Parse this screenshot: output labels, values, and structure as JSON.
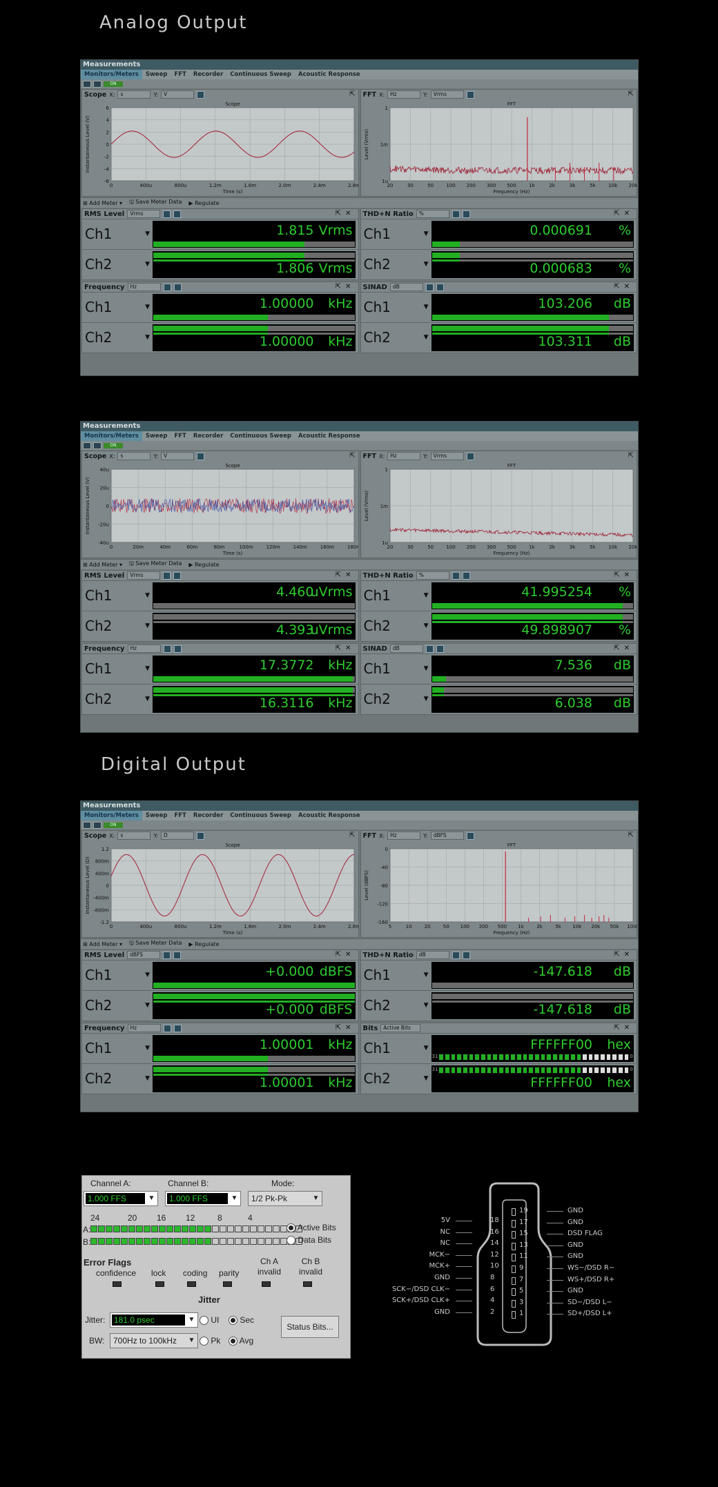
{
  "sections": {
    "analog": "Analog Output",
    "digital": "Digital Output"
  },
  "window": {
    "title": "Measurements",
    "tabs": [
      "Monitors/Meters",
      "Sweep",
      "FFT",
      "Recorder",
      "Continuous Sweep",
      "Acoustic Response"
    ],
    "on_label": "ON",
    "toolbar": {
      "add_meter": "Add Meter",
      "save_meter_data": "Save Meter Data",
      "regulate": "Regulate"
    }
  },
  "panel1": {
    "scope": {
      "title": "Scope",
      "x_label": "X:",
      "x_unit": "s",
      "y_label": "Y:",
      "y_unit": "V",
      "plot_title": "Scope",
      "xlabel": "Time (s)",
      "ylabel": "Instantaneous Level (V)",
      "yticks": [
        "6",
        "4",
        "2",
        "0",
        "-2",
        "-4",
        "-6"
      ],
      "xticks": [
        "0",
        "400u",
        "800u",
        "1.2m",
        "1.6m",
        "2.0m",
        "2.4m",
        "2.8m"
      ]
    },
    "fft": {
      "title": "FFT",
      "x_label": "X:",
      "x_unit": "Hz",
      "y_label": "Y:",
      "y_unit": "Vrms",
      "plot_title": "FFT",
      "xlabel": "Frequency (Hz)",
      "ylabel": "Level (Vrms)",
      "yticks": [
        "1",
        "1m",
        "1u"
      ],
      "xticks": [
        "20",
        "30",
        "50",
        "100",
        "200",
        "300",
        "500",
        "1k",
        "2k",
        "3k",
        "5k",
        "10k",
        "20k"
      ]
    },
    "rms": {
      "title": "RMS Level",
      "unit_sel": "Vrms",
      "ch1": "Ch1",
      "ch2": "Ch2",
      "v1": "1.815",
      "v2": "1.806",
      "u": "Vrms",
      "f1": 0.75,
      "f2": 0.75
    },
    "thd": {
      "title": "THD+N Ratio",
      "unit_sel": "%",
      "ch1": "Ch1",
      "ch2": "Ch2",
      "v1": "0.000691",
      "v2": "0.000683",
      "u": "%",
      "f1": 0.14,
      "f2": 0.14
    },
    "freq": {
      "title": "Frequency",
      "unit_sel": "Hz",
      "ch1": "Ch1",
      "ch2": "Ch2",
      "v1": "1.00000",
      "v2": "1.00000",
      "u": "kHz",
      "f1": 0.57,
      "f2": 0.57
    },
    "sinad": {
      "title": "SINAD",
      "unit_sel": "dB",
      "ch1": "Ch1",
      "ch2": "Ch2",
      "v1": "103.206",
      "v2": "103.311",
      "u": "dB",
      "f1": 0.88,
      "f2": 0.88
    }
  },
  "panel2": {
    "scope": {
      "title": "Scope",
      "x_label": "X:",
      "x_unit": "s",
      "y_label": "Y:",
      "y_unit": "V",
      "plot_title": "Scope",
      "xlabel": "Time (s)",
      "ylabel": "Instantaneous Level (V)",
      "yticks": [
        "40u",
        "20u",
        "0",
        "-20u",
        "-40u"
      ],
      "xticks": [
        "0",
        "20m",
        "40m",
        "60m",
        "80m",
        "100m",
        "120m",
        "140m",
        "160m",
        "180m"
      ]
    },
    "fft": {
      "title": "FFT",
      "x_label": "X:",
      "x_unit": "Hz",
      "y_label": "Y:",
      "y_unit": "Vrms",
      "plot_title": "FFT",
      "xlabel": "Frequency (Hz)",
      "ylabel": "Level (Vrms)",
      "yticks": [
        "1",
        "1m",
        "1u"
      ],
      "xticks": [
        "20",
        "30",
        "50",
        "100",
        "200",
        "300",
        "500",
        "1k",
        "2k",
        "3k",
        "5k",
        "10k",
        "20k"
      ]
    },
    "rms": {
      "title": "RMS Level",
      "unit_sel": "Vrms",
      "ch1": "Ch1",
      "ch2": "Ch2",
      "v1": "4.460",
      "v2": "4.393",
      "u": "uVrms",
      "f1": 0.0,
      "f2": 0.0
    },
    "thd": {
      "title": "THD+N Ratio",
      "unit_sel": "%",
      "ch1": "Ch1",
      "ch2": "Ch2",
      "v1": "41.995254",
      "v2": "49.898907",
      "u": "%",
      "f1": 0.95,
      "f2": 0.95
    },
    "freq": {
      "title": "Frequency",
      "unit_sel": "Hz",
      "ch1": "Ch1",
      "ch2": "Ch2",
      "v1": "17.3772",
      "v2": "16.3116",
      "u": "kHz",
      "f1": 0.99,
      "f2": 0.99
    },
    "sinad": {
      "title": "SINAD",
      "unit_sel": "dB",
      "ch1": "Ch1",
      "ch2": "Ch2",
      "v1": "7.536",
      "v2": "6.038",
      "u": "dB",
      "f1": 0.07,
      "f2": 0.06
    }
  },
  "panel3": {
    "scope": {
      "title": "Scope",
      "x_label": "X:",
      "x_unit": "s",
      "y_label": "Y:",
      "y_unit": "D",
      "plot_title": "Scope",
      "xlabel": "Time (s)",
      "ylabel": "Instantaneous Level (D)",
      "yticks": [
        "1.2",
        "800m",
        "400m",
        "0",
        "-400m",
        "-800m",
        "-1.2"
      ],
      "xticks": [
        "0",
        "400u",
        "800u",
        "1.2m",
        "1.6m",
        "2.0m",
        "2.4m",
        "2.8m"
      ]
    },
    "fft": {
      "title": "FFT",
      "x_label": "X:",
      "x_unit": "Hz",
      "y_label": "Y:",
      "y_unit": "dBFS",
      "plot_title": "FFT",
      "xlabel": "Frequency (Hz)",
      "ylabel": "Level (dBFS)",
      "yticks": [
        "0",
        "-40",
        "-80",
        "-120",
        "-160"
      ],
      "xticks": [
        "5",
        "10",
        "20",
        "50",
        "100",
        "200",
        "500",
        "1k",
        "2k",
        "5k",
        "10k",
        "20k",
        "50k",
        "100k"
      ]
    },
    "rms": {
      "title": "RMS Level",
      "unit_sel": "dBFS",
      "ch1": "Ch1",
      "ch2": "Ch2",
      "v1": "+0.000",
      "v2": "+0.000",
      "u": "dBFS",
      "f1": 1.0,
      "f2": 1.0
    },
    "thd": {
      "title": "THD+N Ratio",
      "unit_sel": "dB",
      "ch1": "Ch1",
      "ch2": "Ch2",
      "v1": "-147.618",
      "v2": "-147.618",
      "u": "dB",
      "f1": 0.0,
      "f2": 0.0
    },
    "freq": {
      "title": "Frequency",
      "unit_sel": "Hz",
      "ch1": "Ch1",
      "ch2": "Ch2",
      "v1": "1.00001",
      "v2": "1.00001",
      "u": "kHz",
      "f1": 0.57,
      "f2": 0.57
    },
    "bits": {
      "title": "Bits",
      "unit_sel": "Active Bits",
      "ch1": "Ch1",
      "ch2": "Ch2",
      "v1": "FFFFFF00",
      "v2": "FFFFFF00",
      "u": "hex",
      "bit_hi": "31",
      "bit_lo": "0"
    }
  },
  "ctrl": {
    "channel_a": "Channel A:",
    "channel_b": "Channel B:",
    "mode": "Mode:",
    "a_val": "1.000   FFS",
    "b_val": "1.000   FFS",
    "mode_val": "1/2 Pk-Pk",
    "bit_labels": [
      "24",
      "20",
      "16",
      "12",
      "8",
      "4"
    ],
    "row_a": "A:",
    "row_b": "B:",
    "active_bits": "Active Bits",
    "data_bits": "Data Bits",
    "error_flags": "Error Flags",
    "flags": [
      "confidence",
      "lock",
      "coding",
      "parity",
      "Ch A\ninvalid",
      "Ch B\ninvalid"
    ],
    "jitter_title": "Jitter",
    "jitter_label": "Jitter:",
    "jitter_val": "181.0   psec",
    "bw_label": "BW:",
    "bw_val": "700Hz to 100kHz",
    "ui": "UI",
    "sec": "Sec",
    "pk": "Pk",
    "avg": "Avg",
    "status_bits": "Status Bits..."
  },
  "connector": {
    "left": [
      {
        "num": "18",
        "name": "5V"
      },
      {
        "num": "16",
        "name": "NC"
      },
      {
        "num": "14",
        "name": "NC"
      },
      {
        "num": "12",
        "name": "MCK−"
      },
      {
        "num": "10",
        "name": "MCK+"
      },
      {
        "num": "8",
        "name": "GND"
      },
      {
        "num": "6",
        "name": "SCK−/DSD CLK−"
      },
      {
        "num": "4",
        "name": "SCK+/DSD CLK+"
      },
      {
        "num": "2",
        "name": "GND"
      }
    ],
    "right": [
      {
        "num": "19",
        "name": "GND"
      },
      {
        "num": "17",
        "name": "GND"
      },
      {
        "num": "15",
        "name": "DSD FLAG"
      },
      {
        "num": "13",
        "name": "GND"
      },
      {
        "num": "11",
        "name": "GND"
      },
      {
        "num": "9",
        "name": "WS−/DSD R−"
      },
      {
        "num": "7",
        "name": "WS+/DSD R+"
      },
      {
        "num": "5",
        "name": "GND"
      },
      {
        "num": "3",
        "name": "SD−/DSD L−"
      },
      {
        "num": "1",
        "name": "SD+/DSD L+"
      }
    ]
  }
}
